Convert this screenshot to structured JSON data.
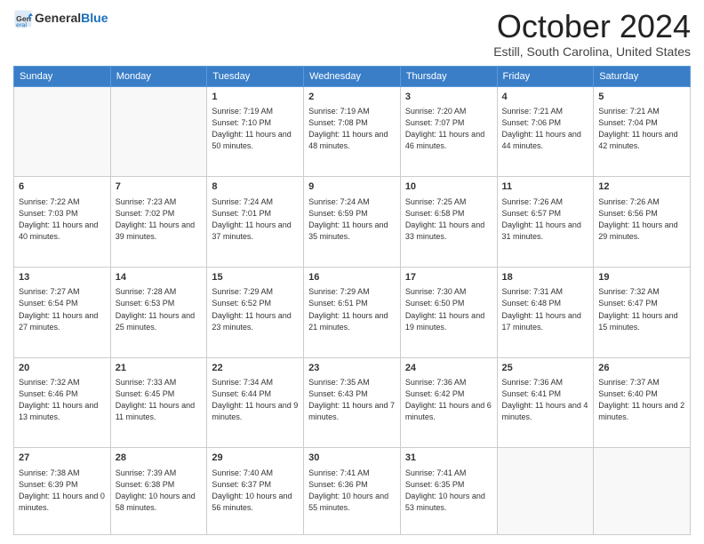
{
  "logo": {
    "general": "General",
    "blue": "Blue"
  },
  "header": {
    "month": "October 2024",
    "location": "Estill, South Carolina, United States"
  },
  "weekdays": [
    "Sunday",
    "Monday",
    "Tuesday",
    "Wednesday",
    "Thursday",
    "Friday",
    "Saturday"
  ],
  "weeks": [
    [
      {
        "day": "",
        "info": ""
      },
      {
        "day": "",
        "info": ""
      },
      {
        "day": "1",
        "info": "Sunrise: 7:19 AM\nSunset: 7:10 PM\nDaylight: 11 hours and 50 minutes."
      },
      {
        "day": "2",
        "info": "Sunrise: 7:19 AM\nSunset: 7:08 PM\nDaylight: 11 hours and 48 minutes."
      },
      {
        "day": "3",
        "info": "Sunrise: 7:20 AM\nSunset: 7:07 PM\nDaylight: 11 hours and 46 minutes."
      },
      {
        "day": "4",
        "info": "Sunrise: 7:21 AM\nSunset: 7:06 PM\nDaylight: 11 hours and 44 minutes."
      },
      {
        "day": "5",
        "info": "Sunrise: 7:21 AM\nSunset: 7:04 PM\nDaylight: 11 hours and 42 minutes."
      }
    ],
    [
      {
        "day": "6",
        "info": "Sunrise: 7:22 AM\nSunset: 7:03 PM\nDaylight: 11 hours and 40 minutes."
      },
      {
        "day": "7",
        "info": "Sunrise: 7:23 AM\nSunset: 7:02 PM\nDaylight: 11 hours and 39 minutes."
      },
      {
        "day": "8",
        "info": "Sunrise: 7:24 AM\nSunset: 7:01 PM\nDaylight: 11 hours and 37 minutes."
      },
      {
        "day": "9",
        "info": "Sunrise: 7:24 AM\nSunset: 6:59 PM\nDaylight: 11 hours and 35 minutes."
      },
      {
        "day": "10",
        "info": "Sunrise: 7:25 AM\nSunset: 6:58 PM\nDaylight: 11 hours and 33 minutes."
      },
      {
        "day": "11",
        "info": "Sunrise: 7:26 AM\nSunset: 6:57 PM\nDaylight: 11 hours and 31 minutes."
      },
      {
        "day": "12",
        "info": "Sunrise: 7:26 AM\nSunset: 6:56 PM\nDaylight: 11 hours and 29 minutes."
      }
    ],
    [
      {
        "day": "13",
        "info": "Sunrise: 7:27 AM\nSunset: 6:54 PM\nDaylight: 11 hours and 27 minutes."
      },
      {
        "day": "14",
        "info": "Sunrise: 7:28 AM\nSunset: 6:53 PM\nDaylight: 11 hours and 25 minutes."
      },
      {
        "day": "15",
        "info": "Sunrise: 7:29 AM\nSunset: 6:52 PM\nDaylight: 11 hours and 23 minutes."
      },
      {
        "day": "16",
        "info": "Sunrise: 7:29 AM\nSunset: 6:51 PM\nDaylight: 11 hours and 21 minutes."
      },
      {
        "day": "17",
        "info": "Sunrise: 7:30 AM\nSunset: 6:50 PM\nDaylight: 11 hours and 19 minutes."
      },
      {
        "day": "18",
        "info": "Sunrise: 7:31 AM\nSunset: 6:48 PM\nDaylight: 11 hours and 17 minutes."
      },
      {
        "day": "19",
        "info": "Sunrise: 7:32 AM\nSunset: 6:47 PM\nDaylight: 11 hours and 15 minutes."
      }
    ],
    [
      {
        "day": "20",
        "info": "Sunrise: 7:32 AM\nSunset: 6:46 PM\nDaylight: 11 hours and 13 minutes."
      },
      {
        "day": "21",
        "info": "Sunrise: 7:33 AM\nSunset: 6:45 PM\nDaylight: 11 hours and 11 minutes."
      },
      {
        "day": "22",
        "info": "Sunrise: 7:34 AM\nSunset: 6:44 PM\nDaylight: 11 hours and 9 minutes."
      },
      {
        "day": "23",
        "info": "Sunrise: 7:35 AM\nSunset: 6:43 PM\nDaylight: 11 hours and 7 minutes."
      },
      {
        "day": "24",
        "info": "Sunrise: 7:36 AM\nSunset: 6:42 PM\nDaylight: 11 hours and 6 minutes."
      },
      {
        "day": "25",
        "info": "Sunrise: 7:36 AM\nSunset: 6:41 PM\nDaylight: 11 hours and 4 minutes."
      },
      {
        "day": "26",
        "info": "Sunrise: 7:37 AM\nSunset: 6:40 PM\nDaylight: 11 hours and 2 minutes."
      }
    ],
    [
      {
        "day": "27",
        "info": "Sunrise: 7:38 AM\nSunset: 6:39 PM\nDaylight: 11 hours and 0 minutes."
      },
      {
        "day": "28",
        "info": "Sunrise: 7:39 AM\nSunset: 6:38 PM\nDaylight: 10 hours and 58 minutes."
      },
      {
        "day": "29",
        "info": "Sunrise: 7:40 AM\nSunset: 6:37 PM\nDaylight: 10 hours and 56 minutes."
      },
      {
        "day": "30",
        "info": "Sunrise: 7:41 AM\nSunset: 6:36 PM\nDaylight: 10 hours and 55 minutes."
      },
      {
        "day": "31",
        "info": "Sunrise: 7:41 AM\nSunset: 6:35 PM\nDaylight: 10 hours and 53 minutes."
      },
      {
        "day": "",
        "info": ""
      },
      {
        "day": "",
        "info": ""
      }
    ]
  ]
}
